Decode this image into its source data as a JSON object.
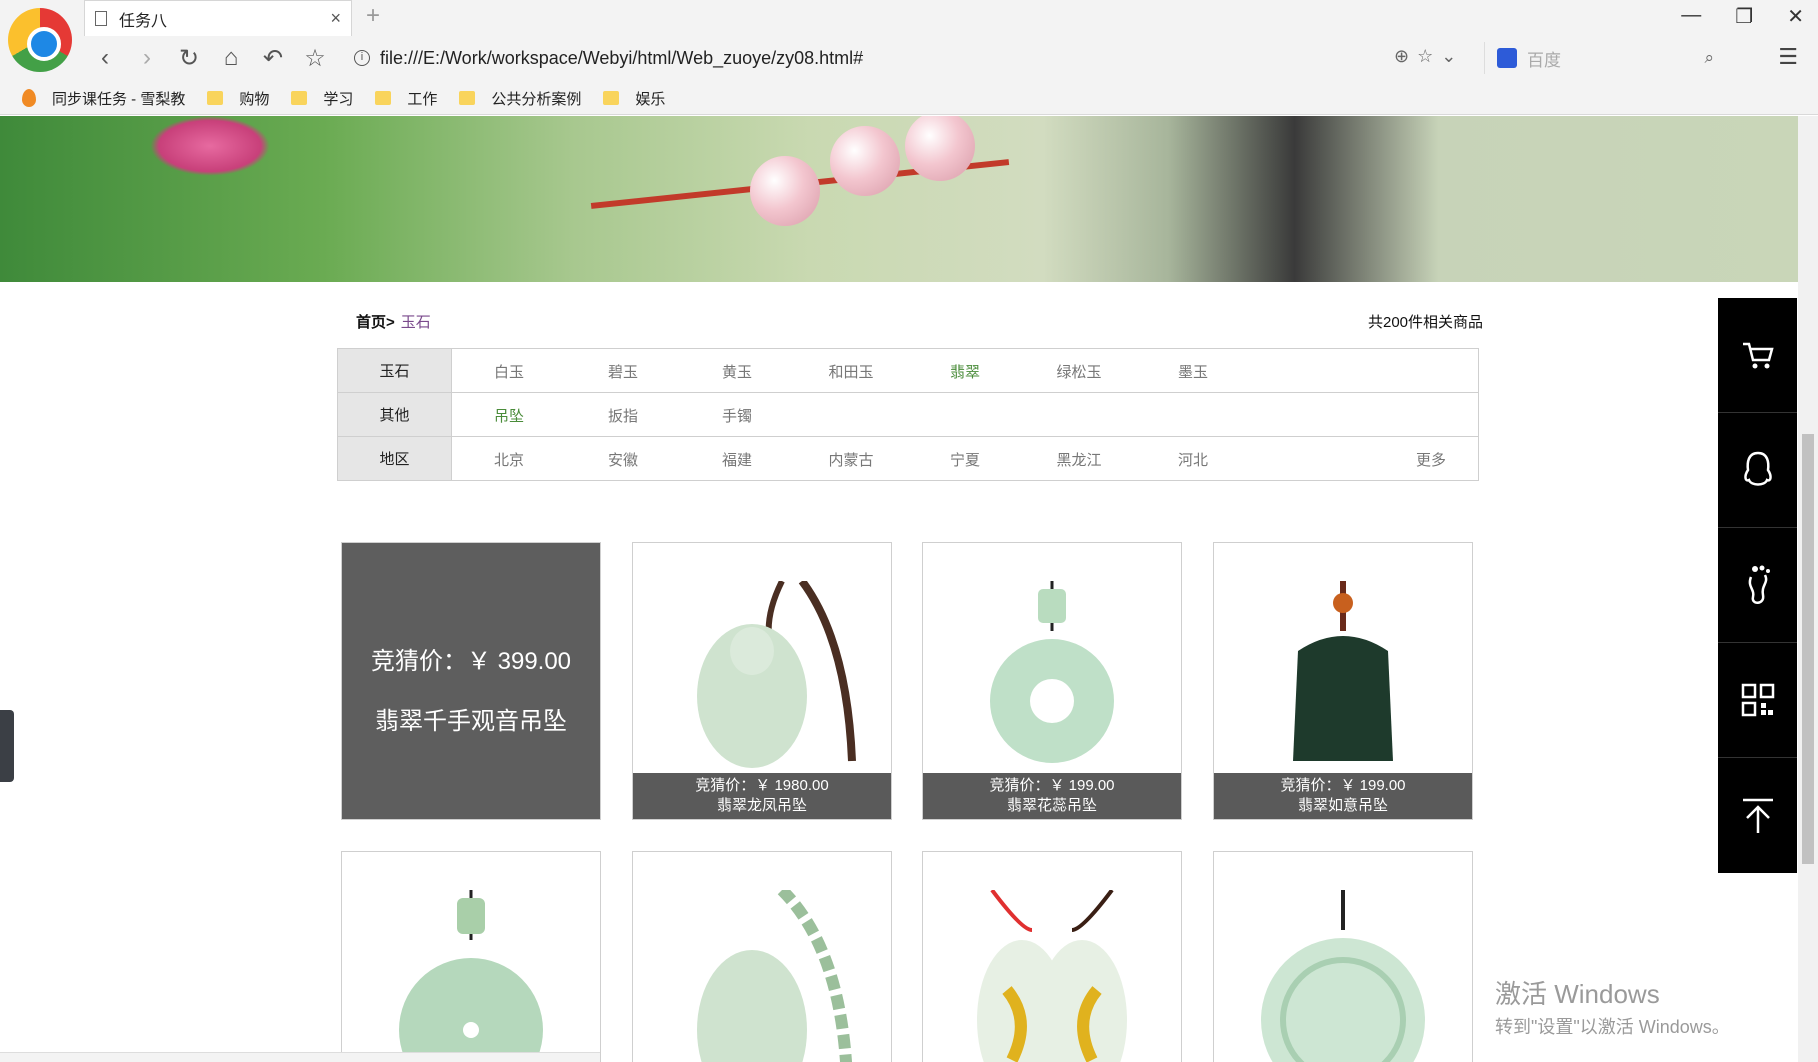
{
  "browser": {
    "tab_title": "任务八",
    "new_tab": "+",
    "address": "file:///E:/Work/workspace/Webyi/html/Web_zuoye/zy08.html#",
    "search_placeholder": "百度",
    "bookmarks": [
      "同步课任务 - 雪梨教",
      "购物",
      "学习",
      "工作",
      "公共分析案例",
      "娱乐"
    ]
  },
  "page": {
    "breadcrumb": {
      "home": "首页>",
      "current": "玉石"
    },
    "result_count": "共200件相关商品",
    "filters": [
      {
        "head": "玉石",
        "options": [
          "白玉",
          "碧玉",
          "黄玉",
          "和田玉",
          "翡翠",
          "绿松玉",
          "墨玉"
        ],
        "active": "翡翠"
      },
      {
        "head": "其他",
        "options": [
          "吊坠",
          "扳指",
          "手镯"
        ],
        "active": "吊坠"
      },
      {
        "head": "地区",
        "options": [
          "北京",
          "安徽",
          "福建",
          "内蒙古",
          "宁夏",
          "黑龙江",
          "河北"
        ],
        "more": "更多"
      }
    ],
    "products": [
      {
        "price": "竞猜价：￥ 399.00",
        "name": "翡翠千手观音吊坠",
        "hovered": true
      },
      {
        "price": "竞猜价：￥ 1980.00",
        "name": "翡翠龙凤吊坠"
      },
      {
        "price": "竞猜价：￥ 199.00",
        "name": "翡翠花蕊吊坠"
      },
      {
        "price": "竞猜价：￥ 199.00",
        "name": "翡翠如意吊坠"
      }
    ]
  },
  "watermark": {
    "line1": "激活 Windows",
    "line2": "转到\"设置\"以激活 Windows。"
  },
  "icons": {
    "sidebar": [
      "cart-icon",
      "qq-icon",
      "footprint-icon",
      "qrcode-icon",
      "back-to-top-icon"
    ]
  }
}
